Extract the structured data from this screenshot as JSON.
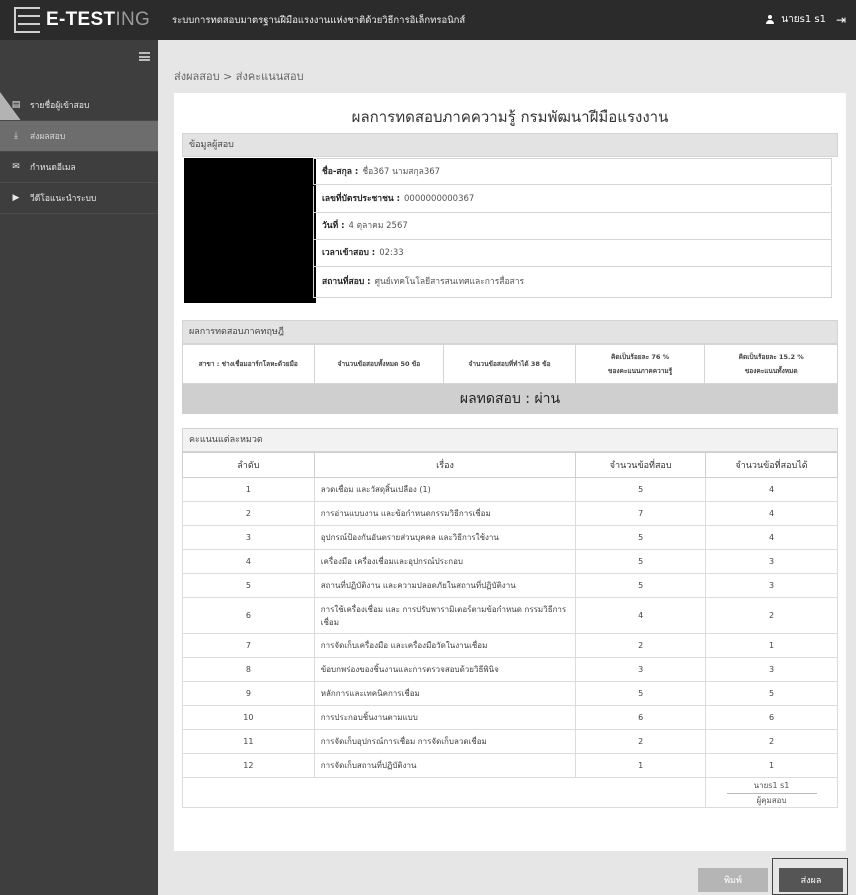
{
  "header": {
    "logo_main": "E-TEST",
    "logo_light": "ING",
    "system_title": "ระบบการทดสอบมาตรฐานฝีมือแรงงานแห่งชาติด้วยวิธีการอิเล็กทรอนิกส์",
    "user_name": "นายs1 s1",
    "user_icon": "user-icon",
    "logout_icon": "logout-icon"
  },
  "sidebar": {
    "items": [
      {
        "label": "รายชื่อผู้เข้าสอบ",
        "icon": "list-icon",
        "active": false
      },
      {
        "label": "ส่งผลสอบ",
        "icon": "upload-icon",
        "active": true
      },
      {
        "label": "กำหนดอีเมล",
        "icon": "mail-icon",
        "active": false
      },
      {
        "label": "วีดีโอแนะนำระบบ",
        "icon": "play-icon",
        "active": false
      }
    ]
  },
  "breadcrumb": "ส่งผลสอบ > ส่งคะแนนสอบ",
  "report": {
    "title": "ผลการทดสอบภาคความรู้ กรมพัฒนาฝีมือแรงงาน",
    "candidate_section": "ข้อมูลผู้สอบ",
    "info": [
      {
        "label": "ชื่อ-สกุล :",
        "value": "ชื่อ367 นามสกุล367"
      },
      {
        "label": "เลขที่บัตรประชาชน :",
        "value": "0000000000367"
      },
      {
        "label": "วันที่ :",
        "value": "4 ตุลาคม 2567"
      },
      {
        "label": "เวลาเข้าสอบ :",
        "value": "02:33"
      },
      {
        "label": "สถานที่สอบ :",
        "value": "ศูนย์เทคโนโลยีสารสนเทศและการสื่อสาร"
      }
    ],
    "theory_section": "ผลการทดสอบภาคทฤษฎี",
    "summary": {
      "branch": "สาขา : ช่างเชื่อมอาร์กโลหะด้วยมือ",
      "total_questions": "จำนวนข้อสอบทั้งหมด 50 ข้อ",
      "correct": "จำนวนข้อสอบที่ทำได้ 38 ข้อ",
      "pct_knowledge_line1": "คิดเป็นร้อยละ 76 %",
      "pct_knowledge_line2": "ของคะแนนภาคความรู้",
      "pct_total_line1": "คิดเป็นร้อยละ 15.2 %",
      "pct_total_line2": "ของคะแนนทั้งหมด"
    },
    "result": "ผลทดสอบ : ผ่าน",
    "category_section": "คะแนนแต่ละหมวด",
    "table_headers": [
      "ลำดับ",
      "เรื่อง",
      "จำนวนข้อที่สอบ",
      "จำนวนข้อที่สอบได้"
    ],
    "rows": [
      {
        "no": "1",
        "topic": "ลวดเชื่อม และวัสดุสิ้นเปลือง (1)",
        "asked": "5",
        "scored": "4"
      },
      {
        "no": "2",
        "topic": "การอ่านแบบงาน และข้อกำหนดกรรมวิธีการเชื่อม",
        "asked": "7",
        "scored": "4"
      },
      {
        "no": "3",
        "topic": "อุปกรณ์ป้องกันอันตรายส่วนบุคคล และวิธีการใช้งาน",
        "asked": "5",
        "scored": "4"
      },
      {
        "no": "4",
        "topic": "เครื่องมือ เครื่องเชื่อมและอุปกรณ์ประกอบ",
        "asked": "5",
        "scored": "3"
      },
      {
        "no": "5",
        "topic": "สถานที่ปฏิบัติงาน และความปลอดภัยในสถานที่ปฏิบัติงาน",
        "asked": "5",
        "scored": "3"
      },
      {
        "no": "6",
        "topic": "การใช้เครื่องเชื่อม และ การปรับพารามิเตอร์ตามข้อกำหนด กรรมวิธีการเชื่อม",
        "asked": "4",
        "scored": "2"
      },
      {
        "no": "7",
        "topic": "การจัดเก็บเครื่องมือ และเครื่องมือวัดในงานเชื่อม",
        "asked": "2",
        "scored": "1"
      },
      {
        "no": "8",
        "topic": "ข้อบกพร่องของชิ้นงานและการตรวจสอบด้วยวิธีพินิจ",
        "asked": "3",
        "scored": "3"
      },
      {
        "no": "9",
        "topic": "หลักการและเทคนิคการเชื่อม",
        "asked": "5",
        "scored": "5"
      },
      {
        "no": "10",
        "topic": "การประกอบชิ้นงานตามแบบ",
        "asked": "6",
        "scored": "6"
      },
      {
        "no": "11",
        "topic": "การจัดเก็บอุปกรณ์การเชื่อม การจัดเก็บลวดเชื่อม",
        "asked": "2",
        "scored": "2"
      },
      {
        "no": "12",
        "topic": "การจัดเก็บสถานที่ปฏิบัติงาน",
        "asked": "1",
        "scored": "1"
      }
    ],
    "signer_name": "นายs1 s1",
    "signer_role": "ผู้คุมสอบ"
  },
  "buttons": {
    "print": "พิมพ์",
    "send": "ส่งผล"
  }
}
